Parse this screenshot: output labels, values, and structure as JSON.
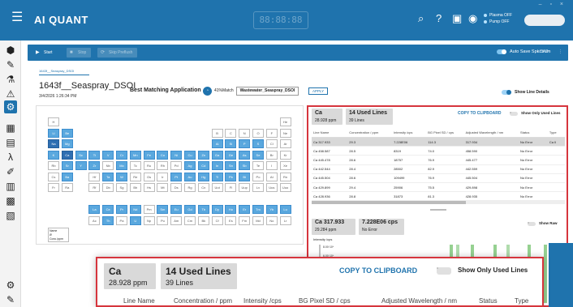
{
  "app": {
    "title": "AI QUANT",
    "clock": "88:88:88",
    "status": [
      "Plasma OFF",
      "Pump OFF"
    ]
  },
  "toolbar": {
    "start": "Start",
    "stop": "Stop",
    "skip": "Skip Preflush",
    "autosave": "Auto Save Spectrum",
    "load": "LOAD"
  },
  "sample": {
    "breadcrumb": "1643f__Seaspray_DSOI",
    "name": "1643f__Seaspray_DSOI",
    "date": "3/4/2026 1:26:34 PM"
  },
  "matching": {
    "label": "Best Matching Application",
    "percent": "41%Match",
    "application": "Wastewater_Seaspray_DSOI",
    "apply": "APPLY",
    "show_line_details": "Show Line Details"
  },
  "lines_panel": {
    "element": "Ca",
    "concentration": "28.928 ppm",
    "used_lines": "14 Used Lines",
    "line_count": "39 Lines",
    "copy": "COPY TO CLIPBOARD",
    "show_only_used": "Show Only Used Lines",
    "columns": [
      "Line Name",
      "Concentration / ppm",
      "Intensity /cps",
      "BG Pixel SD / cps",
      "Adjusted Wavelength / nm",
      "Status",
      "Type"
    ],
    "rows": [
      [
        "Ca 317.933",
        "29.3",
        "7.228E06",
        "114.3",
        "317.934",
        "No Error",
        "Ca II"
      ],
      [
        "Ca 458.587",
        "28.5",
        "8319",
        "74.0",
        "458.590",
        "No Error",
        ""
      ],
      [
        "Ca 445.478",
        "28.6",
        "18757",
        "76.9",
        "445.477",
        "No Error",
        ""
      ],
      [
        "Ca 442.544",
        "28.4",
        "28502",
        "82.9",
        "442.559",
        "No Error",
        ""
      ],
      [
        "Ca 445.504",
        "28.6",
        "109499",
        "76.9",
        "445.504",
        "No Error",
        ""
      ],
      [
        "Ca 429.899",
        "29.4",
        "25906",
        "75.5",
        "429.898",
        "No Error",
        ""
      ],
      [
        "Ca 428.936",
        "28.8",
        "31873",
        "81.3",
        "428.935",
        "No Error",
        ""
      ]
    ]
  },
  "spectrum": {
    "line": "Ca 317.933",
    "concentration": "29.284 ppm",
    "intensity": "7.228E06 cps",
    "status": "No Error",
    "show_raw": "Show Raw",
    "ylabel": "Intensity /cps",
    "ticks": [
      "8.00·10⁶",
      "6.00·10⁶"
    ]
  },
  "zoom": {
    "element": "Ca",
    "concentration": "28.928 ppm",
    "used_lines": "14 Used Lines",
    "line_count": "39 Lines",
    "copy": "COPY TO CLIPBOARD",
    "show_only_used": "Show Only Used Lines",
    "columns": [
      "Line Name",
      "Concentration / ppm",
      "Intensity /cps",
      "BG Pixel SD / cps",
      "Adjusted Wavelength / nm",
      "Status",
      "Type"
    ]
  },
  "periodic": {
    "cells": [
      [
        "H",
        0,
        0,
        ""
      ],
      [
        "He",
        17,
        0,
        ""
      ],
      [
        "Li",
        0,
        1,
        "hi"
      ],
      [
        "Be",
        1,
        1,
        "hi"
      ],
      [
        "B",
        12,
        1,
        ""
      ],
      [
        "C",
        13,
        1,
        ""
      ],
      [
        "N",
        14,
        1,
        ""
      ],
      [
        "O",
        15,
        1,
        ""
      ],
      [
        "F",
        16,
        1,
        ""
      ],
      [
        "Ne",
        17,
        1,
        ""
      ],
      [
        "Na",
        0,
        2,
        "hi2"
      ],
      [
        "Mg",
        1,
        2,
        "hi"
      ],
      [
        "Al",
        12,
        2,
        "hi"
      ],
      [
        "Si",
        13,
        2,
        "hi"
      ],
      [
        "P",
        14,
        2,
        "hi"
      ],
      [
        "S",
        15,
        2,
        "hi"
      ],
      [
        "Cl",
        16,
        2,
        ""
      ],
      [
        "Ar",
        17,
        2,
        ""
      ],
      [
        "K",
        0,
        3,
        "hi"
      ],
      [
        "Ca",
        1,
        3,
        "hi2"
      ],
      [
        "Sc",
        2,
        3,
        "hi"
      ],
      [
        "Ti",
        3,
        3,
        "hi"
      ],
      [
        "V",
        4,
        3,
        "hi"
      ],
      [
        "Cr",
        5,
        3,
        "hi"
      ],
      [
        "Mn",
        6,
        3,
        "hi"
      ],
      [
        "Fe",
        7,
        3,
        "hi"
      ],
      [
        "Co",
        8,
        3,
        "hi"
      ],
      [
        "Ni",
        9,
        3,
        "hi"
      ],
      [
        "Cu",
        10,
        3,
        "hi"
      ],
      [
        "Zn",
        11,
        3,
        "hi"
      ],
      [
        "Ga",
        12,
        3,
        "hi"
      ],
      [
        "Ge",
        13,
        3,
        "hi"
      ],
      [
        "As",
        14,
        3,
        "hi"
      ],
      [
        "Se",
        15,
        3,
        "hi"
      ],
      [
        "Br",
        16,
        3,
        ""
      ],
      [
        "Kr",
        17,
        3,
        ""
      ],
      [
        "Rb",
        0,
        4,
        ""
      ],
      [
        "Sr",
        1,
        4,
        "hi"
      ],
      [
        "Y",
        2,
        4,
        "hi"
      ],
      [
        "Zr",
        3,
        4,
        "hi"
      ],
      [
        "Nb",
        4,
        4,
        ""
      ],
      [
        "Mo",
        5,
        4,
        "hi"
      ],
      [
        "Tc",
        6,
        4,
        ""
      ],
      [
        "Ru",
        7,
        4,
        ""
      ],
      [
        "Rh",
        8,
        4,
        ""
      ],
      [
        "Pd",
        9,
        4,
        ""
      ],
      [
        "Ag",
        10,
        4,
        "hi"
      ],
      [
        "Cd",
        11,
        4,
        "hi"
      ],
      [
        "In",
        12,
        4,
        "hi"
      ],
      [
        "Sn",
        13,
        4,
        "hi"
      ],
      [
        "Sb",
        14,
        4,
        "hi"
      ],
      [
        "Te",
        15,
        4,
        ""
      ],
      [
        "I",
        16,
        4,
        ""
      ],
      [
        "Xe",
        17,
        4,
        ""
      ],
      [
        "Cs",
        0,
        5,
        ""
      ],
      [
        "Ba",
        1,
        5,
        "hi"
      ],
      [
        "Hf",
        3,
        5,
        ""
      ],
      [
        "Ta",
        4,
        5,
        "hi"
      ],
      [
        "W",
        5,
        5,
        "hi"
      ],
      [
        "Re",
        6,
        5,
        ""
      ],
      [
        "Os",
        7,
        5,
        ""
      ],
      [
        "Ir",
        8,
        5,
        ""
      ],
      [
        "Pt",
        9,
        5,
        "hi"
      ],
      [
        "Au",
        10,
        5,
        "hi"
      ],
      [
        "Hg",
        11,
        5,
        "hi"
      ],
      [
        "Tl",
        12,
        5,
        "hi"
      ],
      [
        "Pb",
        13,
        5,
        "hi"
      ],
      [
        "Bi",
        14,
        5,
        "hi"
      ],
      [
        "Po",
        15,
        5,
        ""
      ],
      [
        "At",
        16,
        5,
        ""
      ],
      [
        "Rn",
        17,
        5,
        ""
      ],
      [
        "Fr",
        0,
        6,
        ""
      ],
      [
        "Ra",
        1,
        6,
        ""
      ],
      [
        "Rf",
        3,
        6,
        ""
      ],
      [
        "Db",
        4,
        6,
        ""
      ],
      [
        "Sg",
        5,
        6,
        ""
      ],
      [
        "Bh",
        6,
        6,
        ""
      ],
      [
        "Hs",
        7,
        6,
        ""
      ],
      [
        "Mt",
        8,
        6,
        ""
      ],
      [
        "Ds",
        9,
        6,
        ""
      ],
      [
        "Rg",
        10,
        6,
        ""
      ],
      [
        "Cn",
        11,
        6,
        ""
      ],
      [
        "Uut",
        12,
        6,
        ""
      ],
      [
        "Fl",
        13,
        6,
        ""
      ],
      [
        "Uup",
        14,
        6,
        ""
      ],
      [
        "Lv",
        15,
        6,
        ""
      ],
      [
        "Uus",
        16,
        6,
        ""
      ],
      [
        "Uuo",
        17,
        6,
        ""
      ],
      [
        "La",
        3,
        8,
        "hi"
      ],
      [
        "Ce",
        4,
        8,
        "hi"
      ],
      [
        "Pr",
        5,
        8,
        "hi"
      ],
      [
        "Nd",
        6,
        8,
        "hi"
      ],
      [
        "Pm",
        7,
        8,
        ""
      ],
      [
        "Sm",
        8,
        8,
        "hi"
      ],
      [
        "Eu",
        9,
        8,
        "hi"
      ],
      [
        "Gd",
        10,
        8,
        "hi"
      ],
      [
        "Tb",
        11,
        8,
        "hi"
      ],
      [
        "Dy",
        12,
        8,
        "hi"
      ],
      [
        "Ho",
        13,
        8,
        "hi"
      ],
      [
        "Er",
        14,
        8,
        "hi"
      ],
      [
        "Tm",
        15,
        8,
        "hi"
      ],
      [
        "Yb",
        16,
        8,
        "hi"
      ],
      [
        "Lu",
        17,
        8,
        "hi"
      ],
      [
        "Ac",
        3,
        9,
        ""
      ],
      [
        "Th",
        4,
        9,
        "hi"
      ],
      [
        "Pa",
        5,
        9,
        ""
      ],
      [
        "U",
        6,
        9,
        "hi"
      ],
      [
        "Np",
        7,
        9,
        ""
      ],
      [
        "Pu",
        8,
        9,
        ""
      ],
      [
        "Am",
        9,
        9,
        ""
      ],
      [
        "Cm",
        10,
        9,
        ""
      ],
      [
        "Bk",
        11,
        9,
        ""
      ],
      [
        "Cf",
        12,
        9,
        ""
      ],
      [
        "Es",
        13,
        9,
        ""
      ],
      [
        "Fm",
        14,
        9,
        ""
      ],
      [
        "Md",
        15,
        9,
        ""
      ],
      [
        "No",
        16,
        9,
        ""
      ],
      [
        "Lr",
        17,
        9,
        ""
      ]
    ],
    "legend": [
      "Name",
      "Ø",
      "Conc./ppm"
    ]
  }
}
